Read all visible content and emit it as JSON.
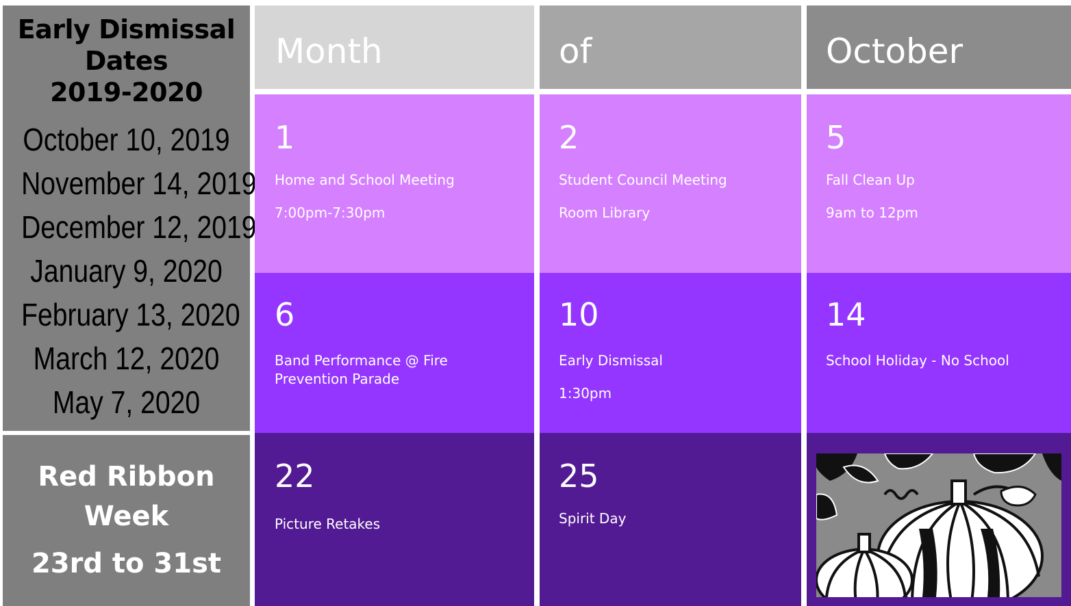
{
  "early_dismissal": {
    "title_line1": "Early Dismissal",
    "title_line2": "Dates",
    "title_line3": "2019-2020",
    "dates": [
      "October 10, 2019",
      "November 14, 2019",
      "December 12, 2019",
      "January 9, 2020",
      "February 13, 2020",
      "March 12, 2020",
      "May 7, 2020"
    ]
  },
  "red_ribbon": {
    "title_line1": "Red Ribbon",
    "title_line2": "Week",
    "dates": "23rd to 31st"
  },
  "header": {
    "col1": "Month",
    "col2": "of",
    "col3": "October"
  },
  "events": [
    {
      "day": "1",
      "line1": "Home and School Meeting",
      "line2": "7:00pm-7:30pm"
    },
    {
      "day": "2",
      "line1": "Student Council Meeting",
      "line2": "Room Library"
    },
    {
      "day": "5",
      "line1": "Fall Clean Up",
      "line2": "9am to 12pm"
    },
    {
      "day": "6",
      "line1": "Band Performance @ Fire Prevention Parade",
      "line2": ""
    },
    {
      "day": "10",
      "line1": "Early Dismissal",
      "line2": "1:30pm"
    },
    {
      "day": "14",
      "line1": "School Holiday - No School",
      "line2": ""
    },
    {
      "day": "22",
      "line1": "Picture Retakes",
      "line2": ""
    },
    {
      "day": "25",
      "line1": "Spirit Day",
      "line2": ""
    }
  ],
  "colors": {
    "row1": "#d580ff",
    "row2": "#9436ff",
    "row3": "#531b93",
    "sidebar": "#808080"
  },
  "image": {
    "icon": "pumpkin-illustration"
  }
}
